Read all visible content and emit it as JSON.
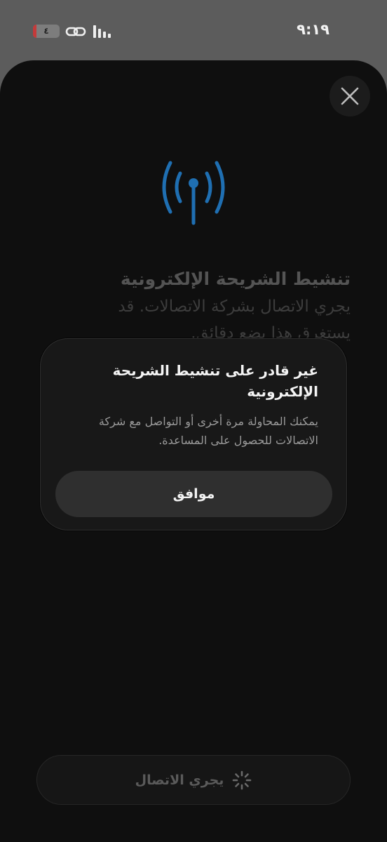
{
  "status_bar": {
    "battery_level": "٤",
    "time": "٩:١٩",
    "icons": [
      "battery-icon",
      "link-icon",
      "signal-icon"
    ]
  },
  "sheet": {
    "close_icon": "close-icon",
    "hero_icon": "antenna-icon",
    "title": "تنشيط الشريحة الإلكترونية",
    "description": "يجري الاتصال بشركة الاتصالات. قد يستغرق هذا بضع دقائق."
  },
  "dialog": {
    "title": "غير قادر على تنشيط الشريحة الإلكترونية",
    "body": "يمكنك المحاولة مرة أخرى أو التواصل مع شركة الاتصالات للحصول على المساعدة.",
    "ok_label": "موافق"
  },
  "bottom_button": {
    "label": "يجري الاتصال",
    "icon": "spinner-icon"
  },
  "colors": {
    "accent": "#1f6fb2",
    "sheet_bg": "#0f0f0f",
    "dialog_bg": "#181818",
    "battery_low": "#c43a3a"
  }
}
